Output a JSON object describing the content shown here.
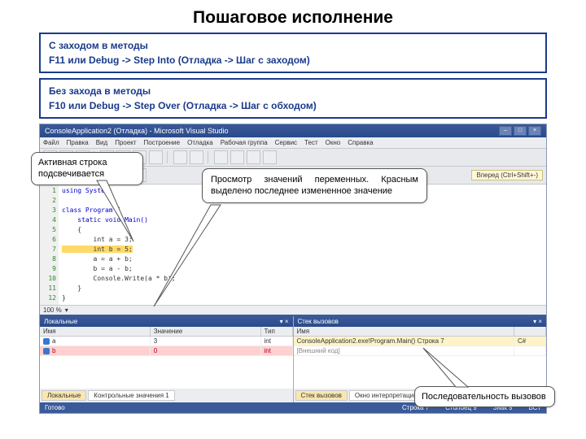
{
  "title": "Пошаговое исполнение",
  "box1": {
    "line1": "С заходом в методы",
    "line2": "F11 или Debug -> Step Into (Отладка ->  Шаг с заходом)"
  },
  "box2": {
    "line1": "Без захода в методы",
    "line2": "F10 или Debug -> Step Over (Отладка -> Шаг с обходом)"
  },
  "callouts": {
    "c1": "Активная строка подсвечивается",
    "c2": "Просмотр значений переменных. Красным выделено последнее измененное значение",
    "c3": "Последовательность вызовов"
  },
  "ide": {
    "window_title": "ConsoleApplication2 (Отладка) - Microsoft Visual Studio",
    "menu": [
      "Файл",
      "Правка",
      "Вид",
      "Проект",
      "Построение",
      "Отладка",
      "Рабочая группа",
      "Сервис",
      "Тест",
      "Окно",
      "Справка"
    ],
    "forward_hint": "Вперед (Ctrl+Shift+-)",
    "gutter": [
      "1",
      "2",
      "3",
      "4",
      "5",
      "6",
      "7",
      "8",
      "9",
      "10",
      "11",
      "12"
    ],
    "code": {
      "l1": "using System;",
      "l2": "",
      "l3": "class Program {",
      "l4": "    static void Main()",
      "l5": "    {",
      "l6": "        int a = 3;",
      "l7": "        int b = 5;",
      "l8": "        a = a + b;",
      "l9": "        b = a - b;",
      "l10": "        Console.Write(a * b);",
      "l11": "    }",
      "l12": "}"
    },
    "zoom": "100 %",
    "locals": {
      "title": "Локальные",
      "cols": {
        "n": "Имя",
        "v": "Значение",
        "t": "Тип"
      },
      "rows": [
        {
          "n": "a",
          "v": "3",
          "t": "int"
        },
        {
          "n": "b",
          "v": "0",
          "t": "int"
        }
      ],
      "tabs": [
        "Локальные",
        "Контрольные значения 1"
      ]
    },
    "stack": {
      "title": "Стек вызовов",
      "cols": {
        "n": "Имя",
        "l": "  "
      },
      "rows": [
        {
          "n": "ConsoleApplication2.exe!Program.Main() Строка 7",
          "l": "C#",
          "hl": true
        },
        {
          "n": "[Внешний код]",
          "l": "",
          "dim": true
        }
      ],
      "tabs": [
        "Стек вызовов",
        "Окно интерпретации"
      ]
    },
    "status": {
      "ready": "Готово",
      "line": "Строка 7",
      "col": "Столбец 9",
      "ch": "Знак 9",
      "ins": "ВСТ"
    }
  }
}
